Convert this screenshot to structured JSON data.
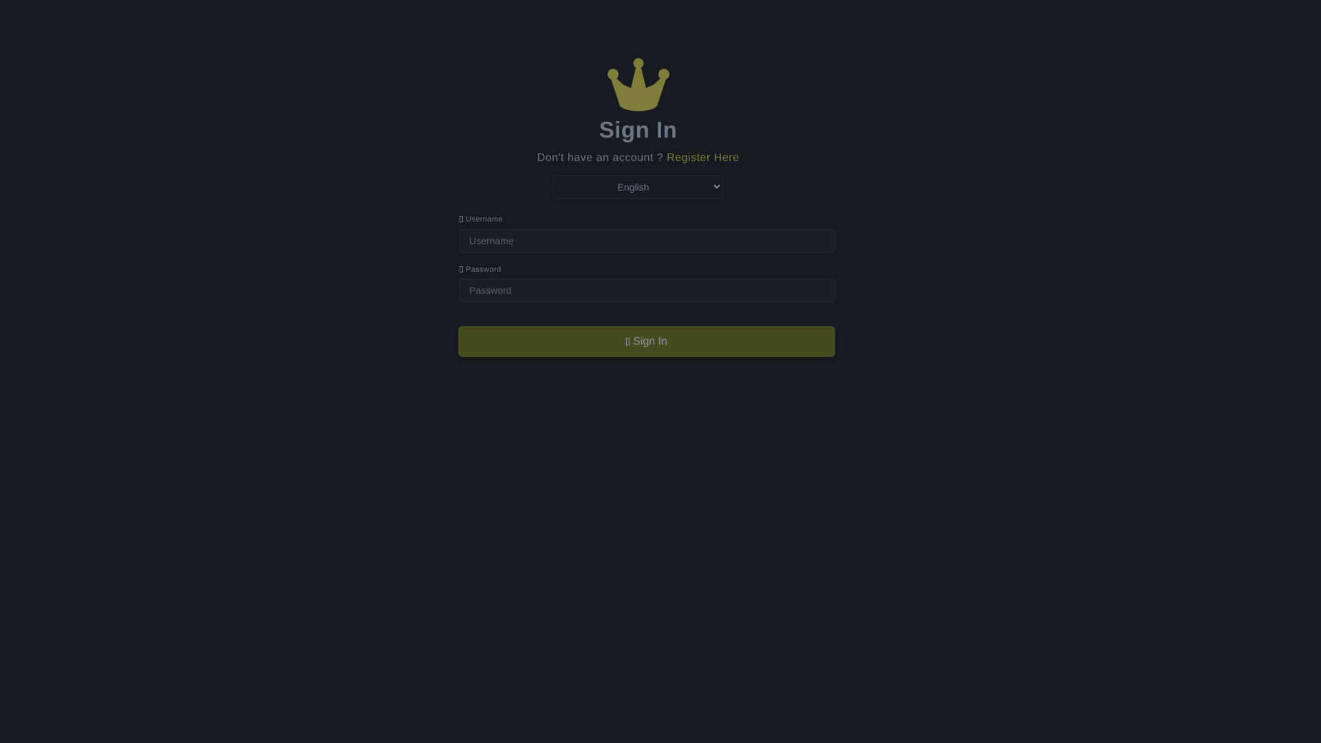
{
  "brand": {
    "logo_icon": "crown-icon",
    "logo_color": "#7f7d3a"
  },
  "header": {
    "title": "Sign In",
    "register_prompt": "Don't have an account ?",
    "register_link": "Register Here"
  },
  "language": {
    "selected": "English",
    "options": [
      "English"
    ]
  },
  "form": {
    "username_label": "Username",
    "username_placeholder": "Username",
    "username_value": "",
    "password_label": "Password",
    "password_placeholder": "Password",
    "password_value": "",
    "submit_label": "Sign In"
  },
  "colors": {
    "background": "#161b22",
    "accent": "#7f7d3a",
    "button": "#454a1f"
  }
}
